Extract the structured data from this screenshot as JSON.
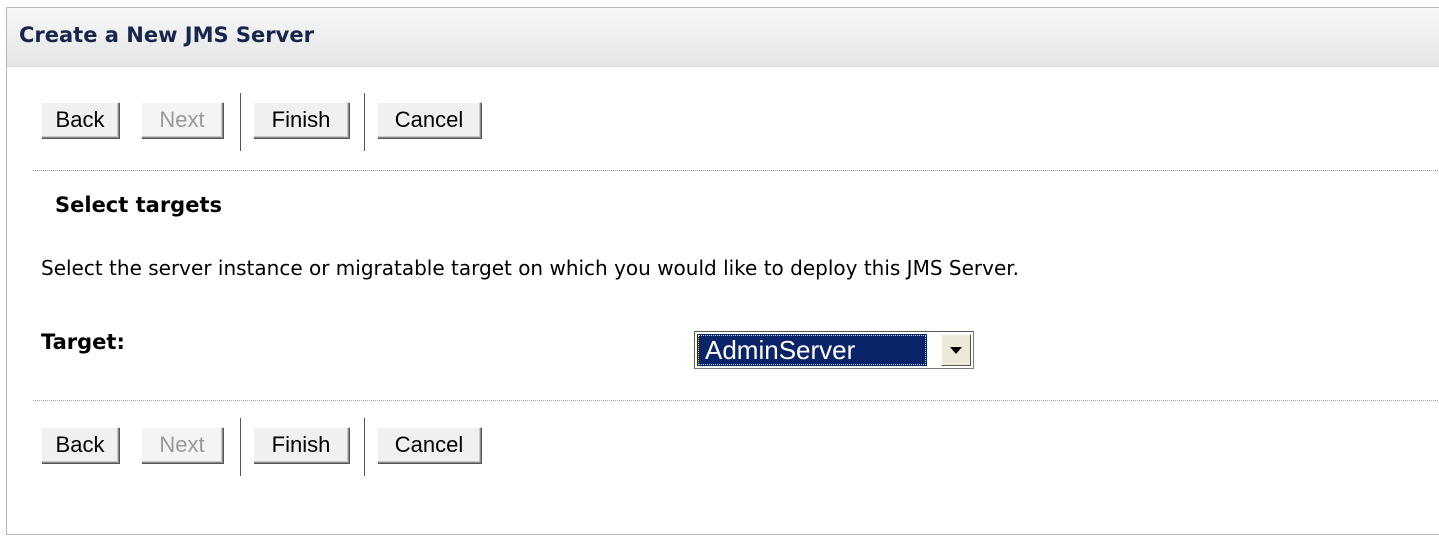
{
  "panel": {
    "title": "Create a New JMS Server"
  },
  "buttons": {
    "back": "Back",
    "next": "Next",
    "finish": "Finish",
    "cancel": "Cancel"
  },
  "section": {
    "title": "Select targets",
    "description": "Select the server instance or migratable target on which you would like to deploy this JMS Server."
  },
  "target": {
    "label": "Target:",
    "selected_value": "AdminServer"
  },
  "icons": {
    "dropdown": "chevron-down-icon"
  },
  "colors": {
    "title_text": "#17264d",
    "selection_highlight": "#0a246a",
    "disabled_text": "#9a9a9a"
  }
}
